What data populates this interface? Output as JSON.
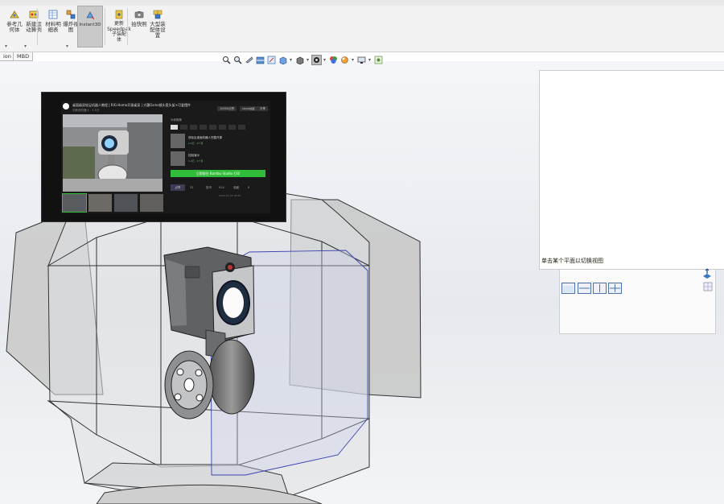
{
  "ribbon": {
    "buttons": [
      {
        "name": "reference-geometry",
        "label": "参考几\n何体"
      },
      {
        "name": "motion-study",
        "label": "新建运\n动算例"
      },
      {
        "name": "bill-of-materials",
        "label": "材料明\n细表"
      },
      {
        "name": "exploded-view",
        "label": "爆炸视\n图"
      },
      {
        "name": "instant3d",
        "label": "Instant3D"
      },
      {
        "name": "update-speedpak",
        "label": "更新\nSpeedpak\n子装配\n体"
      },
      {
        "name": "take-snapshot",
        "label": "拍快照"
      },
      {
        "name": "large-assembly-settings",
        "label": "大型装\n配体设\n置"
      }
    ],
    "tabs": [
      "ion",
      "MBD"
    ]
  },
  "hud": {
    "icons": [
      "zoom-to-fit-icon",
      "zoom-to-area-icon",
      "previous-view-icon",
      "section-view-icon",
      "dynamic-annotation-icon",
      "view-orientation-icon",
      "display-style-icon",
      "hide-show-items-icon",
      "edit-appearance-icon",
      "apply-scene-icon",
      "view-settings-icon",
      "display-pane-icon"
    ]
  },
  "video": {
    "title": "桌面级双轮足机器人教程 | RIG-Home开源桌宠 | 大疆Osmo镜头套头架+可爱摆件",
    "subtitle": "@斯悠机器人 · 1.5万",
    "header_buttons": [
      "10000点赞",
      "18000收藏",
      "分享"
    ],
    "panel_head": "为你推荐",
    "items": [
      {
        "title": "双轮足桌面机器人完整开源",
        "sub": "2.5万 · 5个月"
      },
      {
        "title": "控制演示",
        "sub": "1.9万 · 2个月"
      }
    ],
    "green_button": "立即前往 Bambu Studio 打印",
    "stats": [
      "点赞",
      "32",
      "投币",
      "914",
      "收藏",
      "0"
    ],
    "footer": "2024-03-19 18:00"
  },
  "preview": {
    "tooltip": "单击某个平面以切换视图"
  }
}
